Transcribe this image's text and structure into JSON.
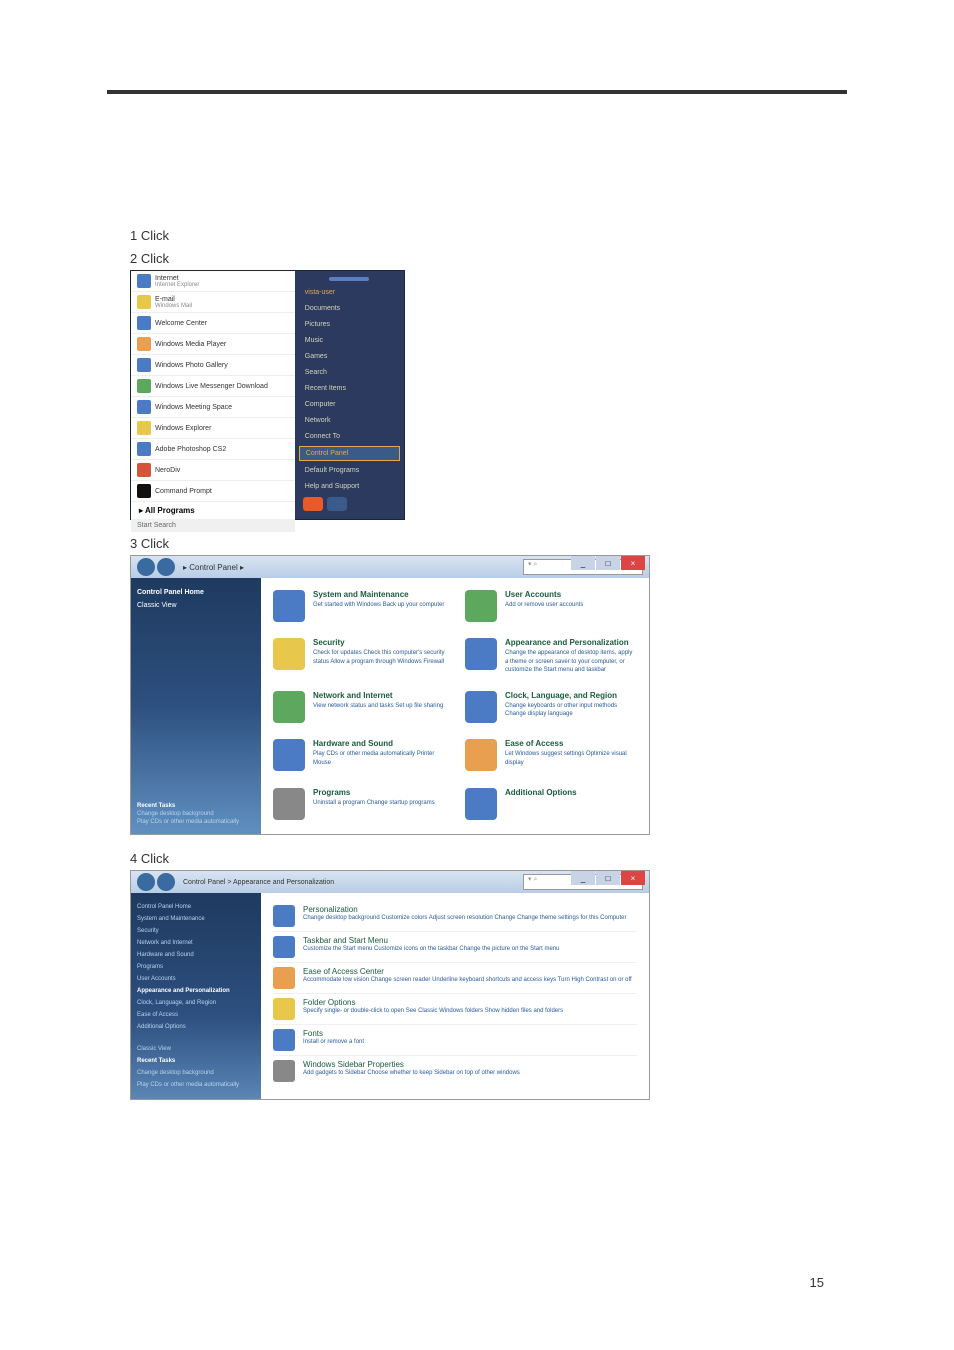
{
  "page_number": "15",
  "steps": {
    "s1": "1 Click",
    "s2": "2 Click",
    "s3": "3 Click",
    "s4": "4 Click"
  },
  "startmenu": {
    "left_items": [
      {
        "label": "Internet",
        "sub": "Internet Explorer"
      },
      {
        "label": "E-mail",
        "sub": "Windows Mail"
      },
      {
        "label": "Welcome Center",
        "sub": ""
      },
      {
        "label": "Windows Media Player",
        "sub": ""
      },
      {
        "label": "Windows Photo Gallery",
        "sub": ""
      },
      {
        "label": "Windows Live Messenger Download",
        "sub": ""
      },
      {
        "label": "Windows Meeting Space",
        "sub": ""
      },
      {
        "label": "Windows Explorer",
        "sub": ""
      },
      {
        "label": "Adobe Photoshop CS2",
        "sub": ""
      },
      {
        "label": "NeroDiv",
        "sub": ""
      },
      {
        "label": "Command Prompt",
        "sub": ""
      }
    ],
    "all_programs": "All Programs",
    "search": "Start Search",
    "right_items": [
      "vista-user",
      "Documents",
      "Pictures",
      "Music",
      "Games",
      "Search",
      "Recent Items",
      "Computer",
      "Network",
      "Connect To",
      "Control Panel",
      "Default Programs",
      "Help and Support"
    ]
  },
  "controlpanel": {
    "breadcrumb": "Control Panel",
    "search_placeholder": "Search",
    "sidebar": {
      "home": "Control Panel Home",
      "classic": "Classic View"
    },
    "categories": [
      {
        "title": "System and Maintenance",
        "links": "Get started with Windows\nBack up your computer"
      },
      {
        "title": "User Accounts",
        "links": "Add or remove user accounts"
      },
      {
        "title": "Security",
        "links": "Check for updates\nCheck this computer's security status\nAllow a program through Windows Firewall"
      },
      {
        "title": "Appearance and Personalization",
        "links": "Change the appearance of desktop items, apply a theme or screen saver to your computer, or customize the Start menu and taskbar"
      },
      {
        "title": "Network and Internet",
        "links": "View network status and tasks\nSet up file sharing"
      },
      {
        "title": "Clock, Language, and Region",
        "links": "Change keyboards or other input methods\nChange display language"
      },
      {
        "title": "Hardware and Sound",
        "links": "Play CDs or other media automatically\nPrinter\nMouse"
      },
      {
        "title": "Ease of Access",
        "links": "Let Windows suggest settings\nOptimize visual display"
      },
      {
        "title": "Programs",
        "links": "Uninstall a program\nChange startup programs"
      },
      {
        "title": "Additional Options",
        "links": ""
      }
    ],
    "related": {
      "header": "Recent Tasks",
      "items": [
        "Change desktop background",
        "Play CDs or other media automatically"
      ]
    }
  },
  "appearance": {
    "breadcrumb": "Control Panel > Appearance and Personalization",
    "search_placeholder": "Search",
    "sidebar_items": [
      "Control Panel Home",
      "System and Maintenance",
      "Security",
      "Network and Internet",
      "Hardware and Sound",
      "Programs",
      "User Accounts",
      "Appearance and Personalization",
      "Clock, Language, and Region",
      "Ease of Access",
      "Additional Options",
      "Classic View"
    ],
    "rows": [
      {
        "title": "Personalization",
        "links": "Change desktop background   Customize colors   Adjust screen resolution\nChange   Change theme settings for this Computer"
      },
      {
        "title": "Taskbar and Start Menu",
        "links": "Customize the Start menu   Customize icons on the taskbar\nChange the picture on the Start menu"
      },
      {
        "title": "Ease of Access Center",
        "links": "Accommodate low vision   Change screen reader\nUnderline keyboard shortcuts and access keys   Turn High Contrast on or off"
      },
      {
        "title": "Folder Options",
        "links": "Specify single- or double-click to open   See Classic Windows folders\nShow hidden files and folders"
      },
      {
        "title": "Fonts",
        "links": "Install or remove a font"
      },
      {
        "title": "Windows Sidebar Properties",
        "links": "Add gadgets to Sidebar   Choose whether to keep Sidebar on top of other windows"
      }
    ],
    "related": {
      "header": "Recent Tasks",
      "items": [
        "Change desktop background",
        "Play CDs or other media automatically"
      ]
    }
  }
}
